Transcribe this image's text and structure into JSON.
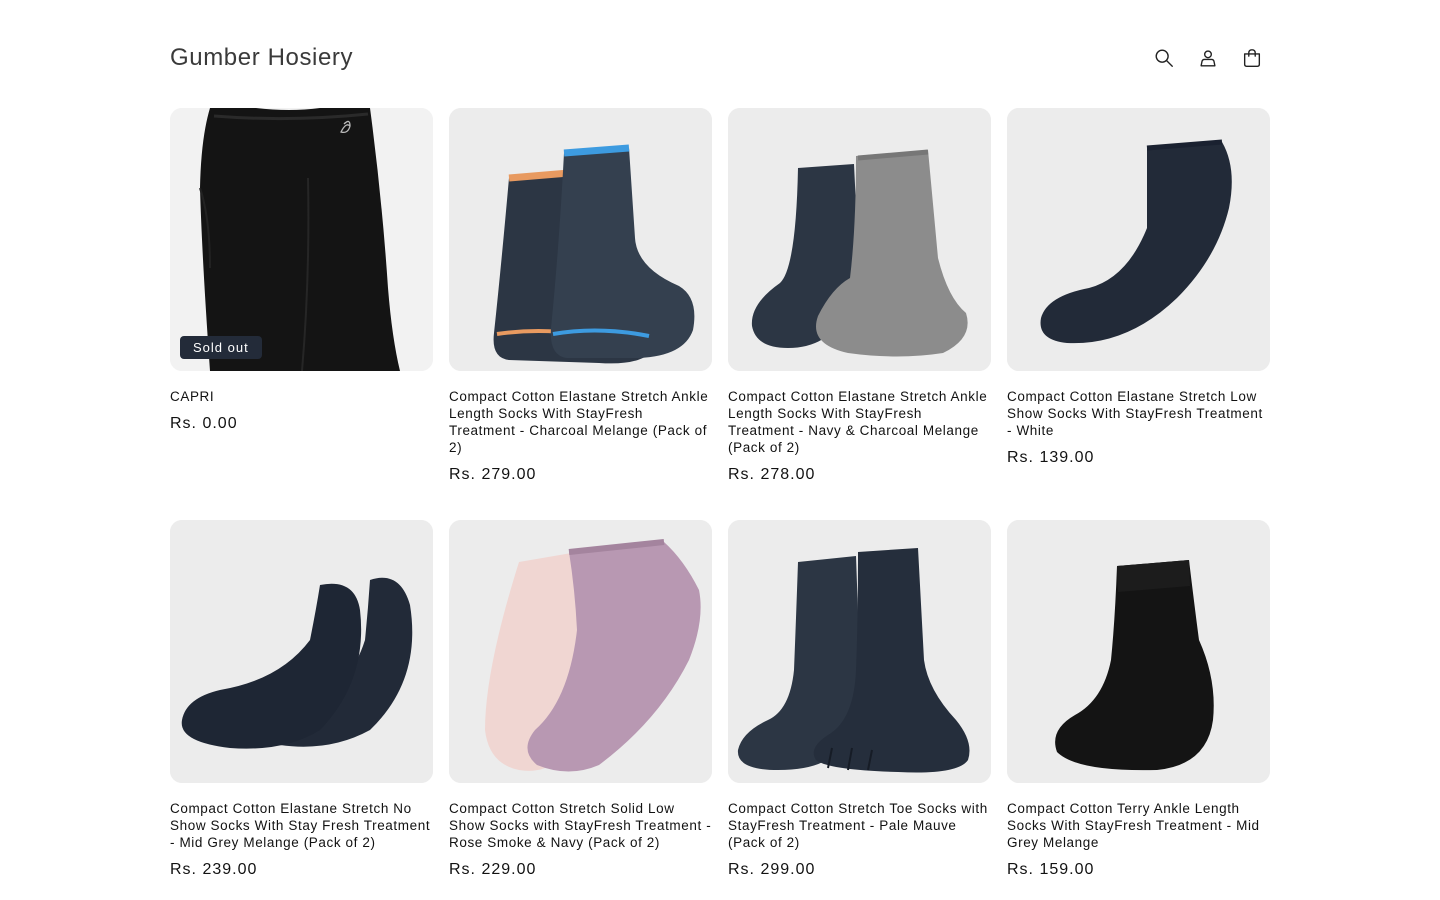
{
  "header": {
    "store_name": "Gumber Hosiery",
    "icons": [
      "search-icon",
      "account-icon",
      "cart-icon"
    ]
  },
  "products": [
    {
      "title": "CAPRI",
      "price": "Rs. 0.00",
      "badge": "Sold out"
    },
    {
      "title": "Compact Cotton Elastane Stretch Ankle Length Socks With StayFresh Treatment - Charcoal Melange (Pack of 2)",
      "price": "Rs. 279.00"
    },
    {
      "title": "Compact Cotton Elastane Stretch Ankle Length Socks With StayFresh Treatment - Navy & Charcoal Melange (Pack of 2)",
      "price": "Rs. 278.00"
    },
    {
      "title": "Compact Cotton Elastane Stretch Low Show Socks With StayFresh Treatment - White",
      "price": "Rs. 139.00"
    },
    {
      "title": "Compact Cotton Elastane Stretch No Show Socks With Stay Fresh Treatment - Mid Grey Melange (Pack of 2)",
      "price": "Rs. 239.00"
    },
    {
      "title": "Compact Cotton Stretch Solid Low Show Socks with StayFresh Treatment - Rose Smoke & Navy (Pack of 2)",
      "price": "Rs. 229.00"
    },
    {
      "title": "Compact Cotton Stretch Toe Socks with StayFresh Treatment - Pale Mauve (Pack of 2)",
      "price": "Rs. 299.00"
    },
    {
      "title": "Compact Cotton Terry Ankle Length Socks With StayFresh Treatment - Mid Grey Melange",
      "price": "Rs. 159.00"
    }
  ],
  "colors": {
    "navy_sock": "#2c3644",
    "charcoal_melange": "#8c8c8c",
    "rose_smoke": "#f0d6d2",
    "pale_mauve": "#b898b2",
    "black_fabric": "#141414",
    "image_bg": "#ececec",
    "badge_bg": "#232b39"
  }
}
